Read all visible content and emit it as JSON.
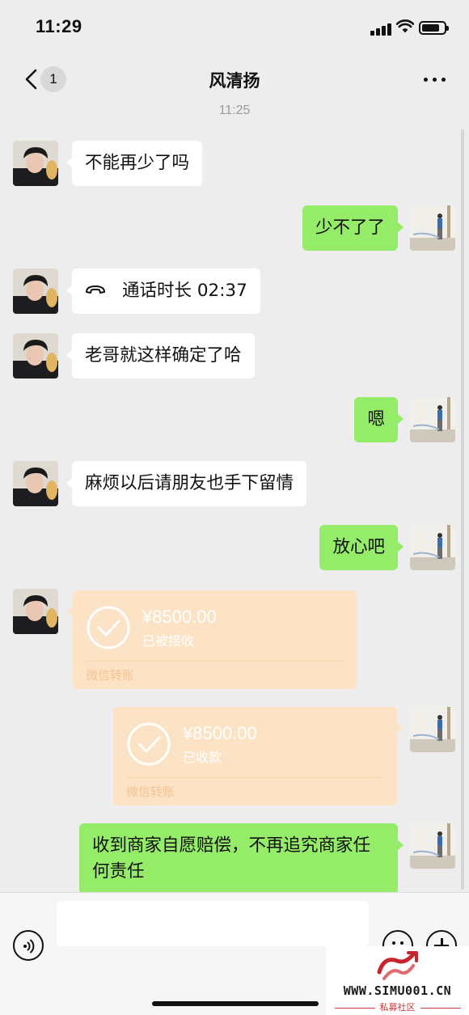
{
  "status_bar": {
    "time": "11:29"
  },
  "nav": {
    "title": "风清扬",
    "unread_count": "1"
  },
  "chat": {
    "timestamp": "11:25",
    "messages": [
      {
        "side": "left",
        "type": "text",
        "text": "不能再少了吗"
      },
      {
        "side": "right",
        "type": "text",
        "text": "少不了了"
      },
      {
        "side": "left",
        "type": "call",
        "text": "通话时长 02:37"
      },
      {
        "side": "left",
        "type": "text",
        "text": "老哥就这样确定了哈"
      },
      {
        "side": "right",
        "type": "text",
        "text": "嗯"
      },
      {
        "side": "left",
        "type": "text",
        "text": "麻烦以后请朋友也手下留情"
      },
      {
        "side": "right",
        "type": "text",
        "text": "放心吧"
      },
      {
        "side": "left",
        "type": "transfer",
        "amount": "¥8500.00",
        "status": "已被接收",
        "label": "微信转账"
      },
      {
        "side": "right",
        "type": "transfer",
        "amount": "¥8500.00",
        "status": "已收款",
        "label": "微信转账"
      },
      {
        "side": "right",
        "type": "text",
        "text": "收到商家自愿赔偿，不再追究商家任何责任"
      }
    ]
  },
  "watermark": {
    "domain": "WWW.SIMU001.CN",
    "label": "私募社区"
  },
  "colors": {
    "my_bubble": "#95ec69",
    "their_bubble": "#ffffff",
    "transfer_card": "#fde3c5",
    "background": "#ededed"
  }
}
